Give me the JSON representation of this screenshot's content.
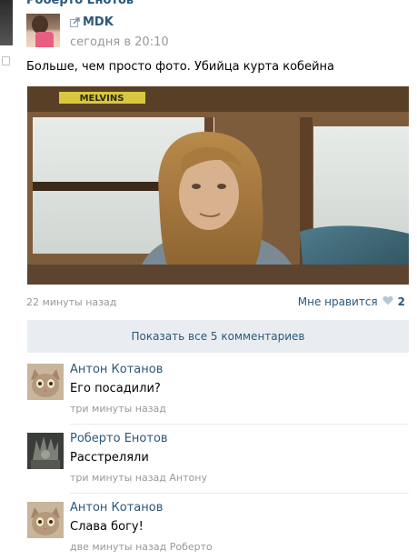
{
  "post": {
    "author": "Роберто Енотов",
    "repost_source": "MDK",
    "time": "сегодня в 20:10",
    "text": "Больше, чем просто фото. Убийца курта кобейна",
    "photo_sign": "MELVINS",
    "footer_time": "22 минуты назад",
    "like_label": "Мне нравится",
    "like_count": "2"
  },
  "comments_toggle": "Показать все 5 комментариев",
  "comments": [
    {
      "author": "Антон Котанов",
      "text": "Его посадили?",
      "meta": "три минуты назад"
    },
    {
      "author": "Роберто Енотов",
      "text": "Расстреляли",
      "meta": "три минуты назад Антону"
    },
    {
      "author": "Антон Котанов",
      "text": "Слава богу!",
      "meta": "две минуты назад Роберто"
    }
  ],
  "colors": {
    "link": "#2b587a",
    "muted": "#999999",
    "toggle_bg": "#e9edf1"
  }
}
